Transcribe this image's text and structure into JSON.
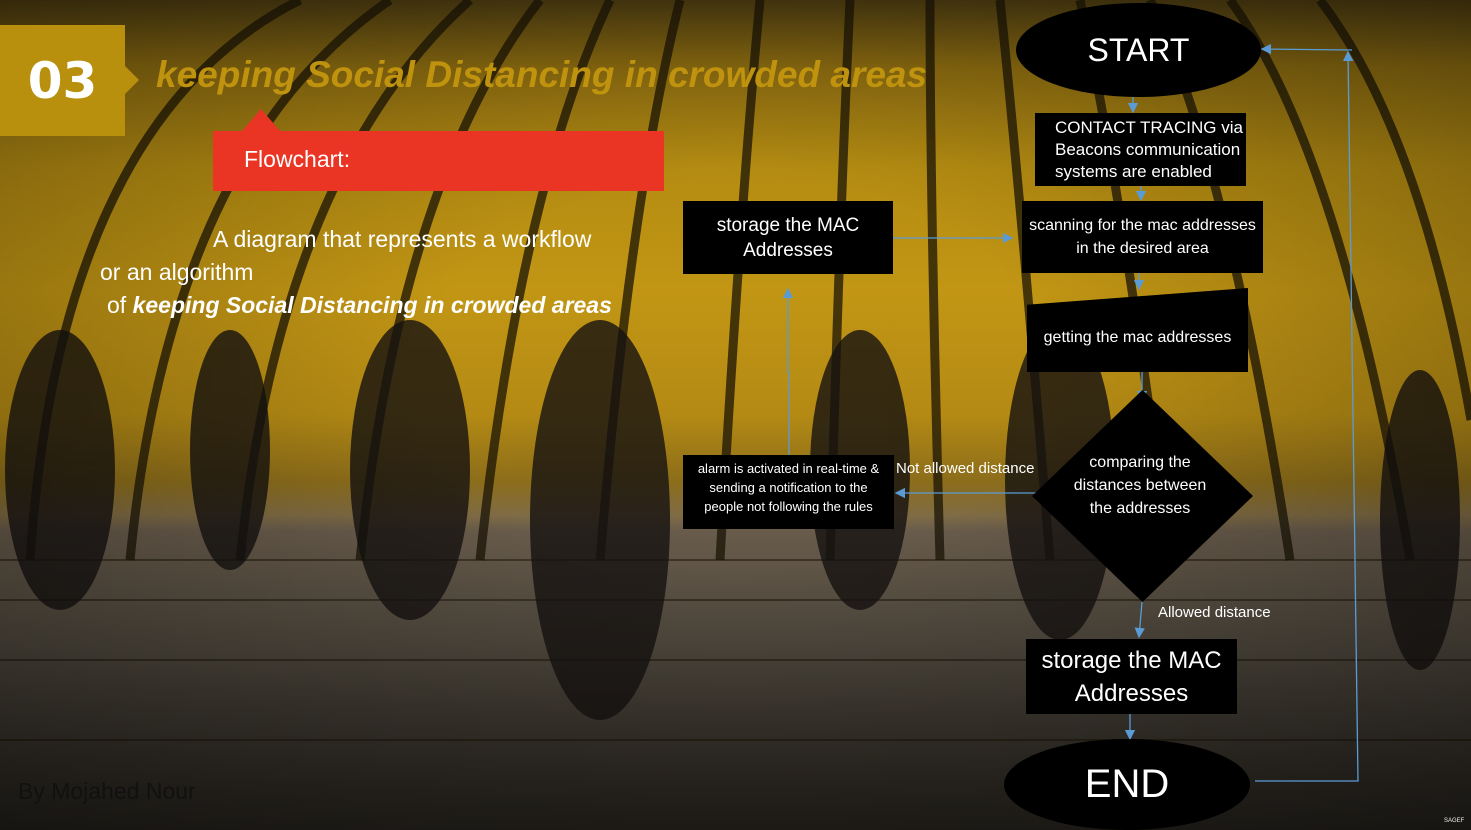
{
  "slide": {
    "number": "03",
    "title": "keeping Social Distancing in crowded areas",
    "section_label": "Flowchart:",
    "description": {
      "line1": "A diagram that represents a workflow",
      "line2": "or an algorithm",
      "line3_prefix": "of",
      "line3_emphasis": "keeping Social Distancing in crowded areas"
    },
    "author": "By Mojahed Nour",
    "image_credit": "SAGEF"
  },
  "flowchart": {
    "start": "START",
    "contact_tracing": "CONTACT TRACING via Beacons communication systems are enabled",
    "scanning": "scanning for the mac addresses in the desired area",
    "getting": "getting the mac addresses",
    "comparing": "comparing the distances between the addresses",
    "not_allowed_label": "Not allowed distance",
    "alarm": "alarm is activated in real-time & sending a notification to the people not following the rules",
    "storage_top": "storage the MAC Addresses",
    "allowed_label": "Allowed distance",
    "storage_bottom": "storage the MAC Addresses",
    "end": "END"
  },
  "colors": {
    "number_box": "#b8900e",
    "title": "#c0930f",
    "flowchart_label": "#ea3424",
    "node_fill": "#000000",
    "connector": "#5b9bd5"
  }
}
